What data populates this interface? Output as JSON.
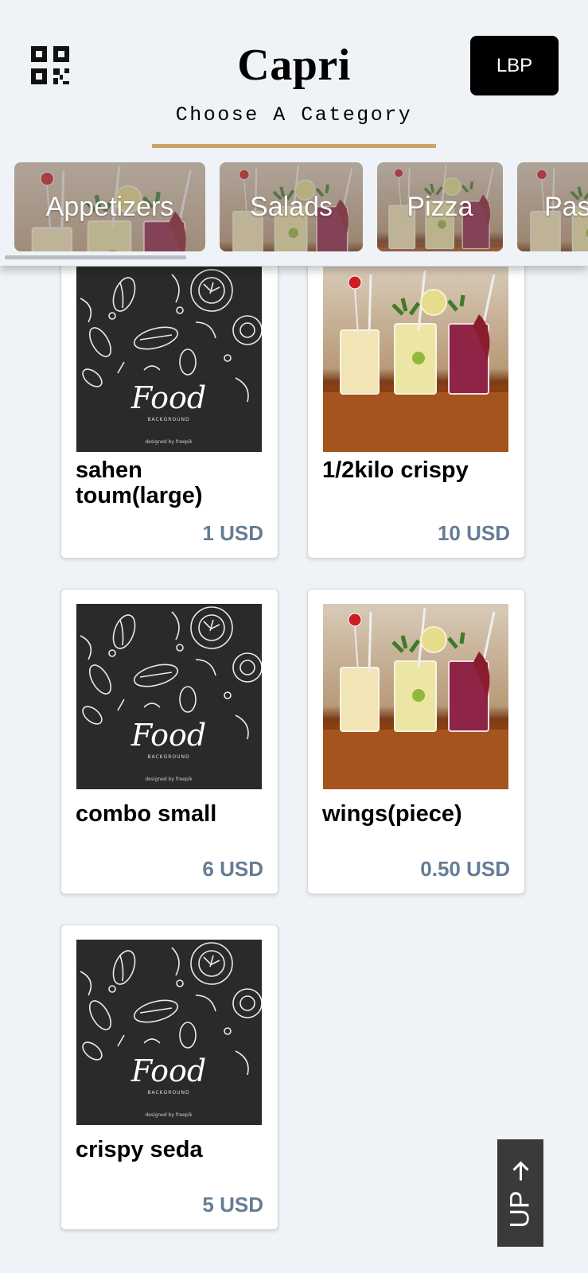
{
  "header": {
    "title": "Capri",
    "subtitle": "Choose A Category",
    "currency_label": "LBP",
    "qr_icon": "qr-code-icon",
    "accent_color": "#c9a46a"
  },
  "categories": [
    {
      "label": "Appetizers"
    },
    {
      "label": "Salads"
    },
    {
      "label": "Pizza"
    },
    {
      "label": "Pas"
    }
  ],
  "products": [
    {
      "name": "sahen toum(large)",
      "price": "1 USD",
      "image": "food-chalkboard-image"
    },
    {
      "name": "1/2kilo crispy",
      "price": "10 USD",
      "image": "cocktails-image"
    },
    {
      "name": "combo small",
      "price": "6 USD",
      "image": "food-chalkboard-image"
    },
    {
      "name": "wings(piece)",
      "price": "0.50 USD",
      "image": "cocktails-image"
    },
    {
      "name": "crispy seda",
      "price": "5 USD",
      "image": "food-chalkboard-image"
    }
  ],
  "up_button": {
    "label": "UP",
    "icon": "arrow-up-icon"
  },
  "colors": {
    "price": "#667c95",
    "background": "#eff3f7"
  },
  "food_image_text": {
    "main": "Food",
    "sub": "BACKGROUND",
    "credit": "designed by freepik"
  }
}
